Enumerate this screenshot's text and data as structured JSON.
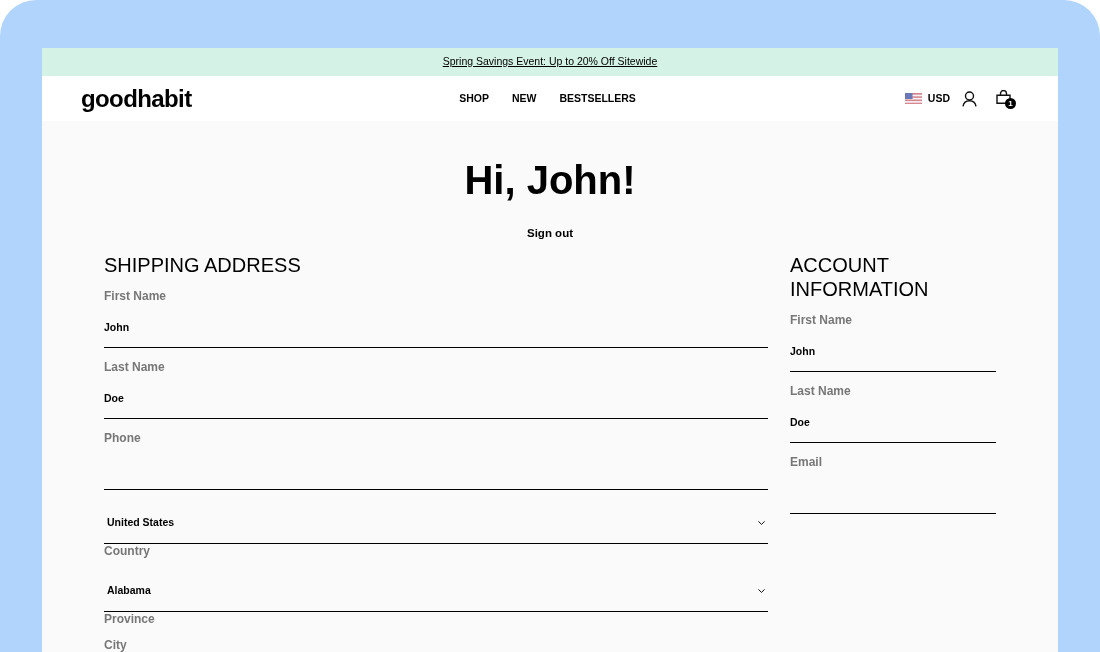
{
  "banner": {
    "link": "Spring Savings Event: Up to 20% Off Sitewide"
  },
  "header": {
    "logo": "goodhabit",
    "nav": [
      "SHOP",
      "NEW",
      "BESTSELLERS"
    ],
    "currency": "USD",
    "cart_count": "1"
  },
  "greeting": "Hi, John!",
  "sign_out": "Sign out",
  "shipping_address": {
    "title": "SHIPPING ADDRESS",
    "fields": [
      {
        "kind": "text",
        "label": "First Name",
        "value": "John"
      },
      {
        "kind": "text",
        "label": "Last Name",
        "value": "Doe"
      },
      {
        "kind": "text",
        "label": "Phone"
      },
      {
        "kind": "select",
        "label": "Country",
        "value": "United States"
      },
      {
        "kind": "select",
        "label": "Province",
        "value": "Alabama"
      },
      {
        "kind": "label",
        "label": "City"
      }
    ]
  },
  "account_information": {
    "title": "ACCOUNT INFORMATION",
    "fields": [
      {
        "kind": "text",
        "label": "First Name",
        "value": "John"
      },
      {
        "kind": "text",
        "label": "Last Name",
        "value": "Doe"
      },
      {
        "kind": "text",
        "label": "Email"
      }
    ]
  }
}
